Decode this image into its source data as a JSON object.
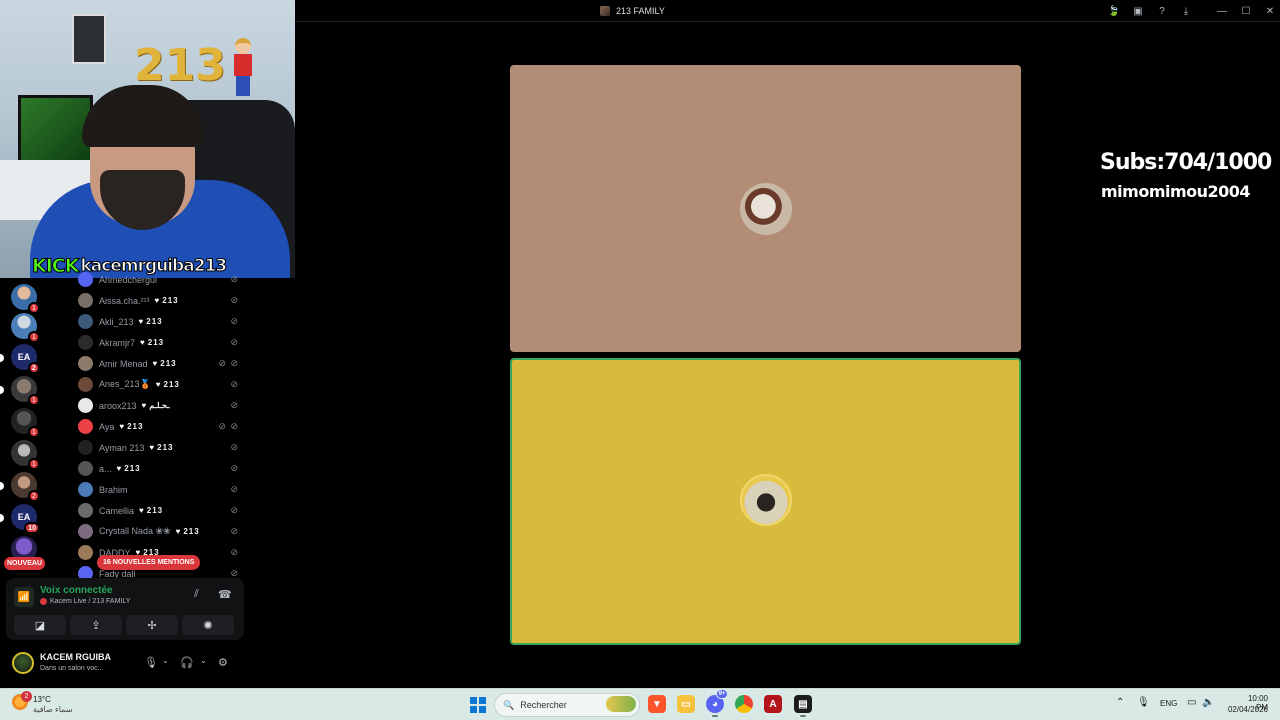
{
  "window": {
    "title": "213 FAMILY",
    "icons": [
      "leaf-icon",
      "screen-share-icon",
      "help-icon",
      "download-icon",
      "minimize-icon",
      "maximize-icon",
      "close-icon"
    ]
  },
  "webcam": {
    "balloon_text": "213",
    "banner_logo": "KICK",
    "banner_user": "kacemrguiba213"
  },
  "servers": [
    {
      "badge": "1"
    },
    {
      "badge": "1"
    },
    {
      "badge": "2",
      "label": "EA"
    },
    {
      "badge": "1"
    },
    {
      "badge": "1"
    },
    {
      "badge": "1"
    },
    {
      "badge": "2"
    },
    {
      "badge": "10",
      "label": "EA"
    },
    {
      "badge": ""
    }
  ],
  "new_badge": "NOUVEAU",
  "members": [
    {
      "name": "Ahmedchergui",
      "tag": ""
    },
    {
      "name": "Aissa.cha.²¹³",
      "tag": "213"
    },
    {
      "name": "Akli_213",
      "tag": "213"
    },
    {
      "name": "Akramjr7",
      "tag": "213"
    },
    {
      "name": "Amir Menad",
      "tag": "213"
    },
    {
      "name": "Anes_213🥉",
      "tag": "213"
    },
    {
      "name": "aroox213",
      "tag": "ـحـلـم"
    },
    {
      "name": "Aya",
      "tag": "213"
    },
    {
      "name": "Ayman 213",
      "tag": "213"
    },
    {
      "name": "a...",
      "tag": "213"
    },
    {
      "name": "Brahim",
      "tag": ""
    },
    {
      "name": "Camellia",
      "tag": "213"
    },
    {
      "name": "Crystall Nada ❀❀",
      "tag": "213"
    },
    {
      "name": "DADDY",
      "tag": "213"
    },
    {
      "name": "Fady dali",
      "tag": ""
    }
  ],
  "mentions_pill": "16 NOUVELLES MENTIONS",
  "voice": {
    "title": "Voix connectée",
    "subtitle": "Kacem Live / 213 FAMILY"
  },
  "user": {
    "name": "KACEM RGUIBA",
    "status": "Dans un salon voc..."
  },
  "overlay": {
    "subs": "Subs:704/1000",
    "username": "mimomimou2004"
  },
  "taskbar": {
    "weather_badge": "2",
    "temperature": "13°C",
    "weather_desc": "سماء صافية",
    "search_placeholder": "Rechercher",
    "discord_badge": "9+",
    "language": "ENG",
    "time": "10:00 PM",
    "date": "02/04/2026"
  },
  "colors": {
    "tile_top": "#b28c74",
    "tile_bottom": "#d8bb3c",
    "speaking_border": "#3ba55d",
    "voice_connected": "#23a55a",
    "kick_green": "#53fc18",
    "mention_red": "#da373c"
  }
}
